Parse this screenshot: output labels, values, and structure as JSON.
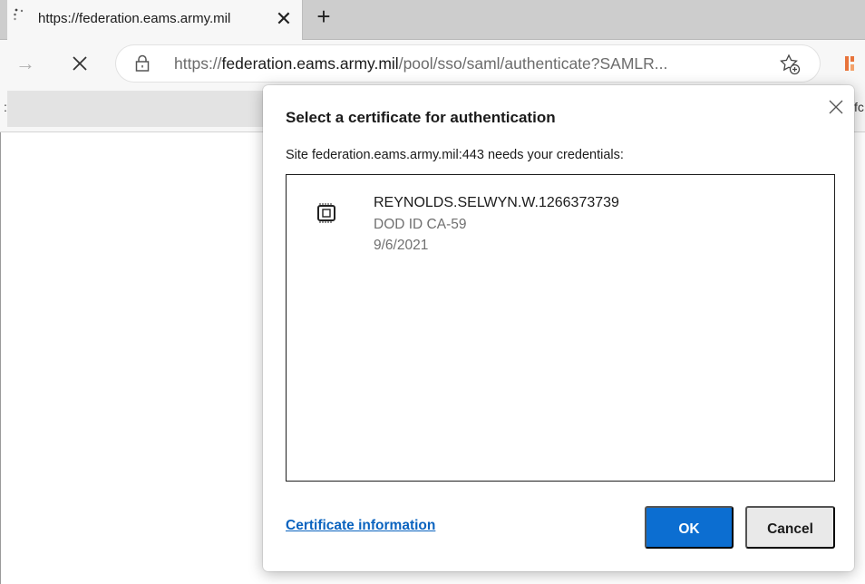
{
  "browser": {
    "tab": {
      "title": "https://federation.eams.army.mil",
      "loading_icon": "loading-spinner-icon",
      "close_icon": "close-icon"
    },
    "new_tab_icon": "plus-icon",
    "toolbar": {
      "forward_icon": "arrow-right-icon",
      "stop_icon": "close-icon",
      "address": {
        "scheme": "https://",
        "host": "federation.eams.army.mil",
        "path": "/pool/sso/saml/authenticate?SAMLR..."
      },
      "lock_icon": "lock-icon",
      "favorite_icon": "add-favorite-icon",
      "extension_icon": "extension-icon"
    },
    "bookmarks_bar": {
      "left_fragment": ":",
      "right_fragment": "fc"
    }
  },
  "dialog": {
    "title": "Select a certificate for authentication",
    "subtitle": "Site federation.eams.army.mil:443 needs your credentials:",
    "close_icon": "close-icon",
    "certificates": [
      {
        "icon": "smart-card-icon",
        "name": "REYNOLDS.SELWYN.W.1266373739",
        "issuer": "DOD ID CA-59",
        "date": "9/6/2021"
      }
    ],
    "certificate_info_link": "Certificate information",
    "ok_label": "OK",
    "cancel_label": "Cancel"
  },
  "colors": {
    "accent": "#0c6ed1",
    "link": "#0a63bf",
    "tabstrip": "#cdcdcd",
    "toolbar": "#f7f7f7"
  }
}
